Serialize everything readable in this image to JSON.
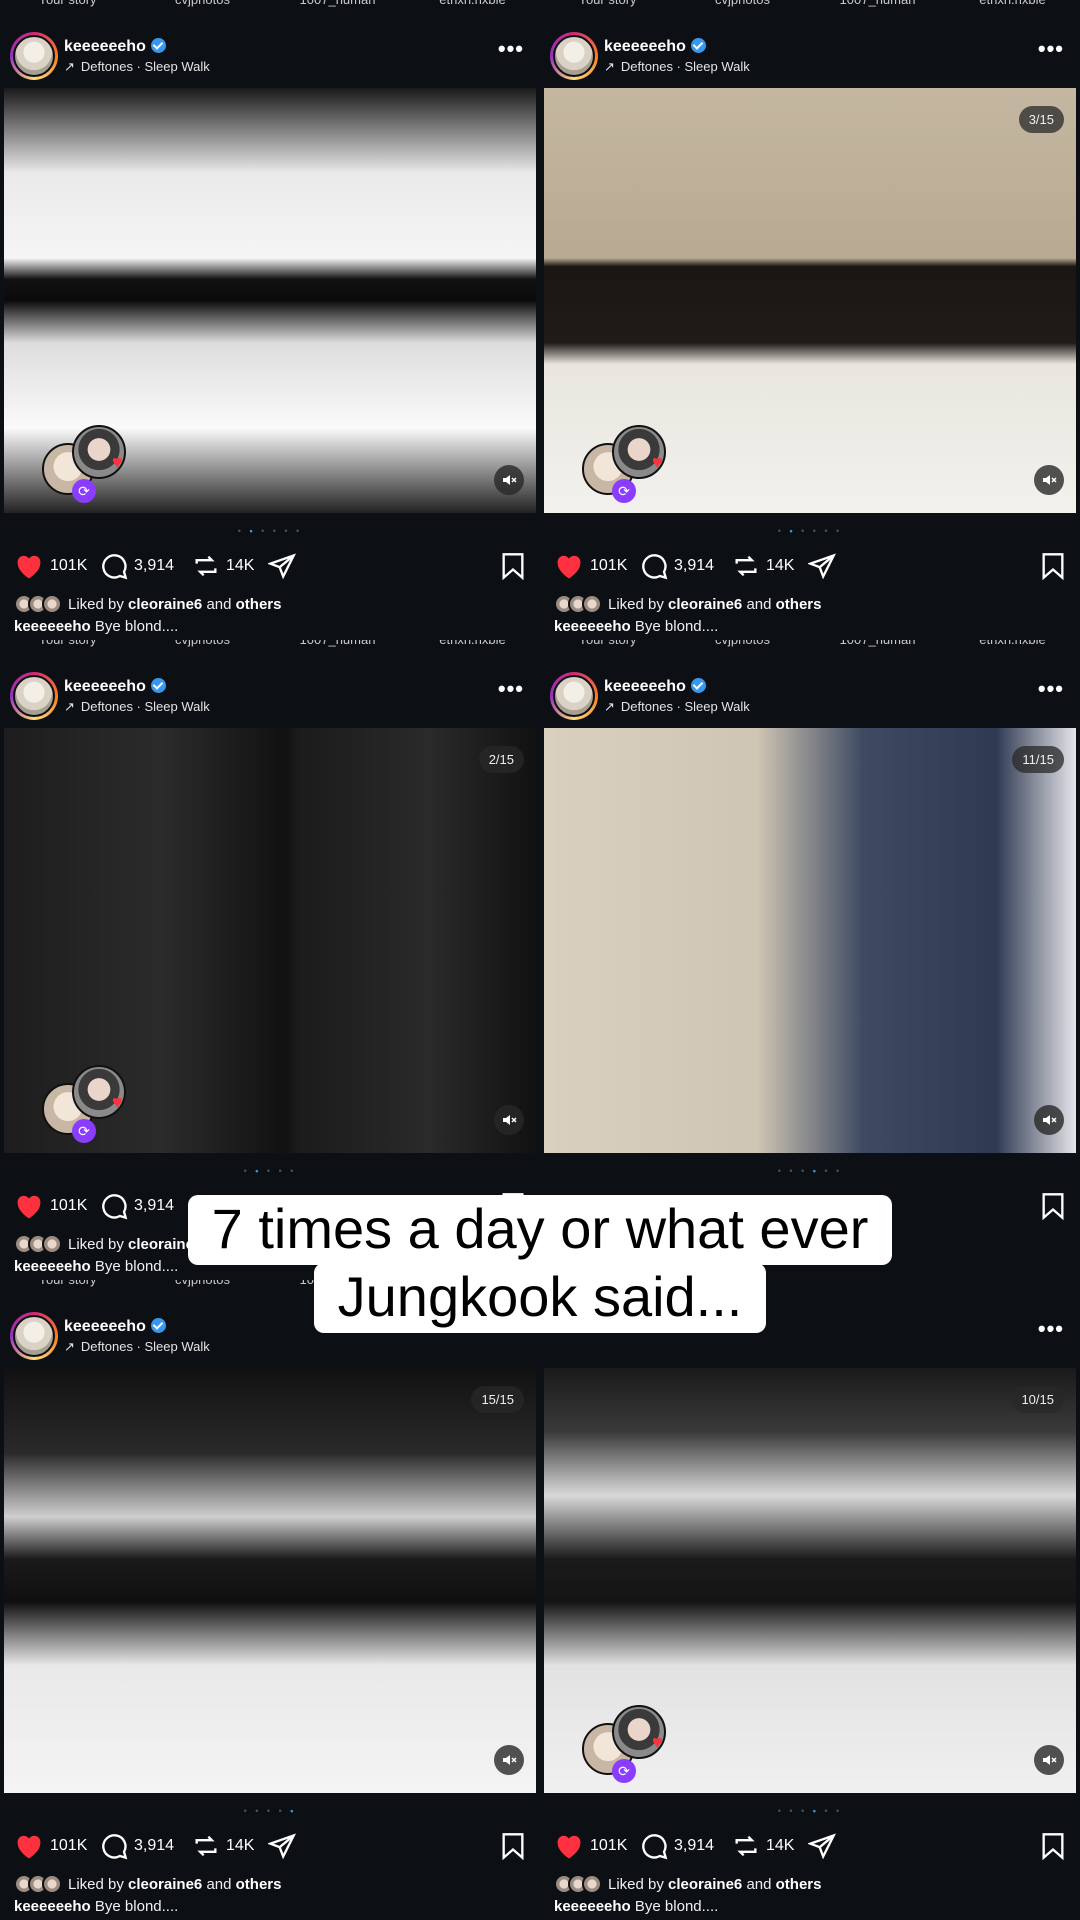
{
  "stories": [
    "Your story",
    "cvjphotos",
    "1007_human",
    "ethxn.nxbie"
  ],
  "post": {
    "username": "keeeeeeho",
    "audio": "Deftones · Sleep Walk",
    "more": "•••",
    "likes_count": "101K",
    "comments_count": "3,914",
    "reposts_count": "14K",
    "liked_by_prefix": "Liked by",
    "liked_by_user": "cleoraine6",
    "liked_by_and": "and",
    "liked_by_others": "others",
    "caption_text": "Bye blond...."
  },
  "posts": [
    {
      "counter": "",
      "dots_active": 2,
      "dots_total": 6,
      "collab": true
    },
    {
      "counter": "3/15",
      "dots_active": 2,
      "dots_total": 6,
      "collab": true
    },
    {
      "counter": "2/15",
      "dots_active": 2,
      "dots_total": 5,
      "collab": true
    },
    {
      "counter": "11/15",
      "dots_active": 4,
      "dots_total": 6,
      "collab": false
    },
    {
      "counter": "15/15",
      "dots_active": 5,
      "dots_total": 5,
      "collab": false
    },
    {
      "counter": "10/15",
      "dots_active": 4,
      "dots_total": 6,
      "collab": true
    }
  ],
  "overlay_caption": {
    "line1": "7 times a day or what ever",
    "line2": "Jungkook said..."
  },
  "colors": {
    "background": "#0c1014",
    "like_red": "#ff3040",
    "verified_blue": "#3897f0",
    "caption_bg": "#ffffff"
  }
}
